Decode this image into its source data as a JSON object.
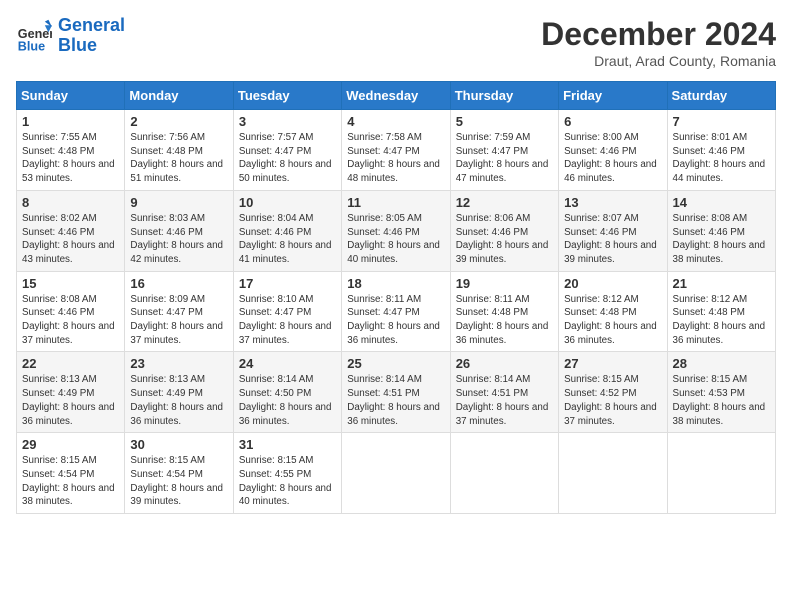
{
  "header": {
    "logo": {
      "text_general": "General",
      "text_blue": "Blue"
    },
    "title": "December 2024",
    "subtitle": "Draut, Arad County, Romania"
  },
  "calendar": {
    "days_of_week": [
      "Sunday",
      "Monday",
      "Tuesday",
      "Wednesday",
      "Thursday",
      "Friday",
      "Saturday"
    ],
    "weeks": [
      [
        {
          "day": "1",
          "sunrise": "7:55 AM",
          "sunset": "4:48 PM",
          "daylight": "8 hours and 53 minutes."
        },
        {
          "day": "2",
          "sunrise": "7:56 AM",
          "sunset": "4:48 PM",
          "daylight": "8 hours and 51 minutes."
        },
        {
          "day": "3",
          "sunrise": "7:57 AM",
          "sunset": "4:47 PM",
          "daylight": "8 hours and 50 minutes."
        },
        {
          "day": "4",
          "sunrise": "7:58 AM",
          "sunset": "4:47 PM",
          "daylight": "8 hours and 48 minutes."
        },
        {
          "day": "5",
          "sunrise": "7:59 AM",
          "sunset": "4:47 PM",
          "daylight": "8 hours and 47 minutes."
        },
        {
          "day": "6",
          "sunrise": "8:00 AM",
          "sunset": "4:46 PM",
          "daylight": "8 hours and 46 minutes."
        },
        {
          "day": "7",
          "sunrise": "8:01 AM",
          "sunset": "4:46 PM",
          "daylight": "8 hours and 44 minutes."
        }
      ],
      [
        {
          "day": "8",
          "sunrise": "8:02 AM",
          "sunset": "4:46 PM",
          "daylight": "8 hours and 43 minutes."
        },
        {
          "day": "9",
          "sunrise": "8:03 AM",
          "sunset": "4:46 PM",
          "daylight": "8 hours and 42 minutes."
        },
        {
          "day": "10",
          "sunrise": "8:04 AM",
          "sunset": "4:46 PM",
          "daylight": "8 hours and 41 minutes."
        },
        {
          "day": "11",
          "sunrise": "8:05 AM",
          "sunset": "4:46 PM",
          "daylight": "8 hours and 40 minutes."
        },
        {
          "day": "12",
          "sunrise": "8:06 AM",
          "sunset": "4:46 PM",
          "daylight": "8 hours and 39 minutes."
        },
        {
          "day": "13",
          "sunrise": "8:07 AM",
          "sunset": "4:46 PM",
          "daylight": "8 hours and 39 minutes."
        },
        {
          "day": "14",
          "sunrise": "8:08 AM",
          "sunset": "4:46 PM",
          "daylight": "8 hours and 38 minutes."
        }
      ],
      [
        {
          "day": "15",
          "sunrise": "8:08 AM",
          "sunset": "4:46 PM",
          "daylight": "8 hours and 37 minutes."
        },
        {
          "day": "16",
          "sunrise": "8:09 AM",
          "sunset": "4:47 PM",
          "daylight": "8 hours and 37 minutes."
        },
        {
          "day": "17",
          "sunrise": "8:10 AM",
          "sunset": "4:47 PM",
          "daylight": "8 hours and 37 minutes."
        },
        {
          "day": "18",
          "sunrise": "8:11 AM",
          "sunset": "4:47 PM",
          "daylight": "8 hours and 36 minutes."
        },
        {
          "day": "19",
          "sunrise": "8:11 AM",
          "sunset": "4:48 PM",
          "daylight": "8 hours and 36 minutes."
        },
        {
          "day": "20",
          "sunrise": "8:12 AM",
          "sunset": "4:48 PM",
          "daylight": "8 hours and 36 minutes."
        },
        {
          "day": "21",
          "sunrise": "8:12 AM",
          "sunset": "4:48 PM",
          "daylight": "8 hours and 36 minutes."
        }
      ],
      [
        {
          "day": "22",
          "sunrise": "8:13 AM",
          "sunset": "4:49 PM",
          "daylight": "8 hours and 36 minutes."
        },
        {
          "day": "23",
          "sunrise": "8:13 AM",
          "sunset": "4:49 PM",
          "daylight": "8 hours and 36 minutes."
        },
        {
          "day": "24",
          "sunrise": "8:14 AM",
          "sunset": "4:50 PM",
          "daylight": "8 hours and 36 minutes."
        },
        {
          "day": "25",
          "sunrise": "8:14 AM",
          "sunset": "4:51 PM",
          "daylight": "8 hours and 36 minutes."
        },
        {
          "day": "26",
          "sunrise": "8:14 AM",
          "sunset": "4:51 PM",
          "daylight": "8 hours and 37 minutes."
        },
        {
          "day": "27",
          "sunrise": "8:15 AM",
          "sunset": "4:52 PM",
          "daylight": "8 hours and 37 minutes."
        },
        {
          "day": "28",
          "sunrise": "8:15 AM",
          "sunset": "4:53 PM",
          "daylight": "8 hours and 38 minutes."
        }
      ],
      [
        {
          "day": "29",
          "sunrise": "8:15 AM",
          "sunset": "4:54 PM",
          "daylight": "8 hours and 38 minutes."
        },
        {
          "day": "30",
          "sunrise": "8:15 AM",
          "sunset": "4:54 PM",
          "daylight": "8 hours and 39 minutes."
        },
        {
          "day": "31",
          "sunrise": "8:15 AM",
          "sunset": "4:55 PM",
          "daylight": "8 hours and 40 minutes."
        },
        null,
        null,
        null,
        null
      ]
    ]
  }
}
